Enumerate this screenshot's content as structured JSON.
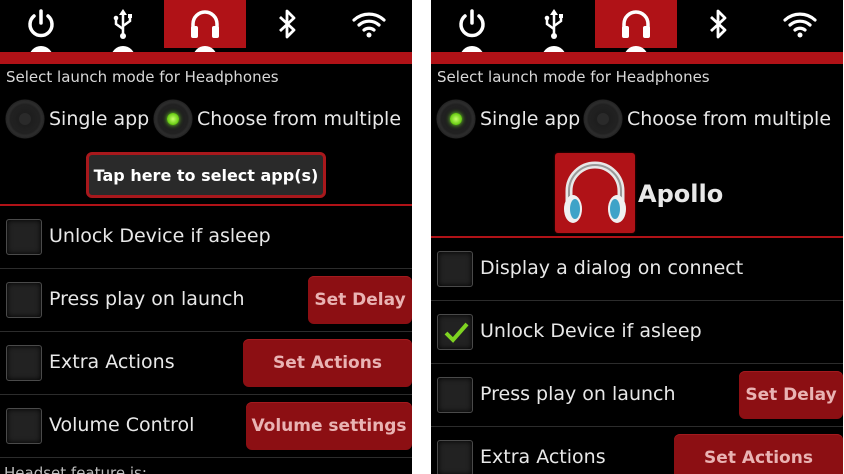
{
  "colors": {
    "accent": "#b01217",
    "background": "#000000",
    "radio_on": "#63c90e",
    "check": "#7ed321"
  },
  "icons": [
    "power-icon",
    "usb-icon",
    "headphones-icon",
    "bluetooth-icon",
    "wifi-icon"
  ],
  "left": {
    "section_title": "Select launch mode for Headphones",
    "radio_single": "Single app",
    "radio_multiple": "Choose from multiple",
    "selected_mode": "Choose from multiple",
    "select_button": "Tap here to select app(s)",
    "options": [
      {
        "label": "Unlock Device if asleep",
        "checked": false
      },
      {
        "label": "Press play on launch",
        "checked": false,
        "button": "Set Delay"
      },
      {
        "label": "Extra Actions",
        "checked": false,
        "button": "Set Actions"
      },
      {
        "label": "Volume Control",
        "checked": false,
        "button": "Volume settings"
      }
    ],
    "footer": "Headset feature is:"
  },
  "right": {
    "section_title": "Select launch mode for Headphones",
    "radio_single": "Single app",
    "radio_multiple": "Choose from multiple",
    "selected_mode": "Single app",
    "app_name": "Apollo",
    "options": [
      {
        "label": "Display a dialog on connect",
        "checked": false
      },
      {
        "label": "Unlock Device if asleep",
        "checked": true
      },
      {
        "label": "Press play on launch",
        "checked": false,
        "button": "Set Delay"
      },
      {
        "label": "Extra Actions",
        "checked": false,
        "button": "Set Actions"
      }
    ]
  }
}
